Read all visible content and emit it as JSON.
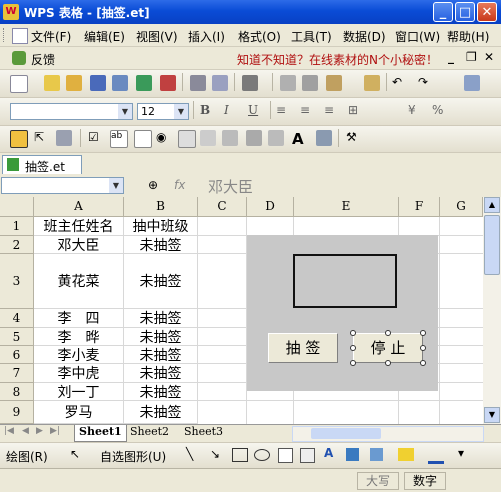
{
  "window": {
    "app_icon": "W",
    "title": "WPS 表格 - [抽签.et]"
  },
  "menu": {
    "items": [
      "文件(F)",
      "编辑(E)",
      "视图(V)",
      "插入(I)",
      "格式(O)",
      "工具(T)",
      "数据(D)",
      "窗口(W)",
      "帮助(H)"
    ]
  },
  "linkbar": {
    "feedback": "反馈",
    "promo": "知道不知道？在线素材的N个小秘密！"
  },
  "format_toolbar": {
    "font_size": "12",
    "bold": "B",
    "italic": "I",
    "underline": "U",
    "percent": "%"
  },
  "doc_tab": {
    "label": "抽签.et"
  },
  "formula_bar": {
    "name_box": "",
    "fx": "fx",
    "content": "邓大臣"
  },
  "grid": {
    "columns": [
      "A",
      "B",
      "C",
      "D",
      "E",
      "F",
      "G"
    ],
    "rows": [
      {
        "num": "1",
        "a": "班主任姓名",
        "b": "抽中班级"
      },
      {
        "num": "2",
        "a": "邓大臣",
        "b": "未抽签"
      },
      {
        "num": "3",
        "a": "黄花菜",
        "b": "未抽签"
      },
      {
        "num": "4",
        "a": "李　四",
        "b": "未抽签"
      },
      {
        "num": "5",
        "a": "李　晔",
        "b": "未抽签"
      },
      {
        "num": "6",
        "a": "李小麦",
        "b": "未抽签"
      },
      {
        "num": "7",
        "a": "李中虎",
        "b": "未抽签"
      },
      {
        "num": "8",
        "a": "刘一丁",
        "b": "未抽签"
      },
      {
        "num": "9",
        "a": "罗马",
        "b": "未抽签"
      }
    ],
    "draw_button": "抽 签",
    "stop_button": "停 止"
  },
  "sheets": [
    "Sheet1",
    "Sheet2",
    "Sheet3"
  ],
  "draw_toolbar": {
    "draw_label": "绘图(R)",
    "autoshape_label": "自选图形(U)"
  },
  "status": {
    "caps": "大写",
    "num": "数字"
  },
  "colors": {
    "titlebar": "#0A4CD6",
    "promo_text": "#B01010",
    "panel": "#C8C8C8"
  }
}
